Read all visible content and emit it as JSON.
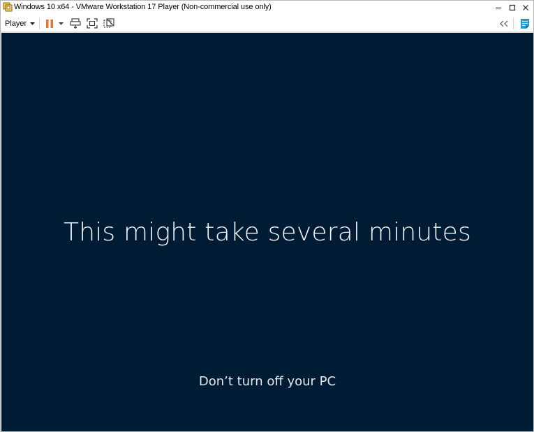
{
  "window": {
    "title": "Windows 10 x64 - VMware Workstation 17 Player (Non-commercial use only)",
    "controls": {
      "minimize": "minimize",
      "maximize": "maximize",
      "close": "close"
    }
  },
  "toolbar": {
    "player_label": "Player",
    "icons": [
      "pause-icon",
      "dropdown-icon",
      "send-ctrl-alt-del-icon",
      "fullscreen-icon",
      "unity-icon",
      "collapse-icon",
      "notes-icon"
    ],
    "accent_pause": "#e07a30",
    "accent_notes": "#1a9bd7"
  },
  "guest": {
    "background": "#001b34",
    "message": "This might take several minutes",
    "submessage": "Don’t turn off your PC"
  }
}
